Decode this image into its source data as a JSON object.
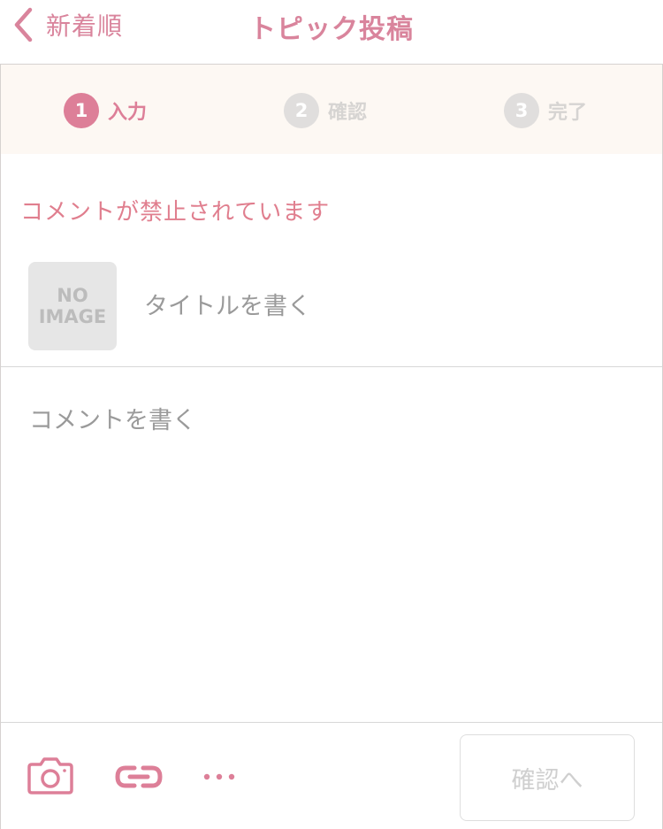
{
  "header": {
    "back_label": "新着順",
    "title": "トピック投稿"
  },
  "steps": [
    {
      "number": "1",
      "label": "入力",
      "active": true
    },
    {
      "number": "2",
      "label": "確認",
      "active": false
    },
    {
      "number": "3",
      "label": "完了",
      "active": false
    }
  ],
  "warning": "コメントが禁止されています",
  "form": {
    "no_image_line1": "NO",
    "no_image_line2": "IMAGE",
    "title_value": "",
    "title_placeholder": "タイトルを書く",
    "comment_value": "",
    "comment_placeholder": "コメントを書く"
  },
  "toolbar": {
    "icons": [
      "camera-icon",
      "link-icon",
      "more-icon"
    ],
    "confirm_label": "確認へ"
  },
  "colors": {
    "accent": "#dd7f98",
    "warning": "#e07e8e",
    "step_bar_bg": "#fdf8f3",
    "inactive_step": "#e0dedd"
  }
}
